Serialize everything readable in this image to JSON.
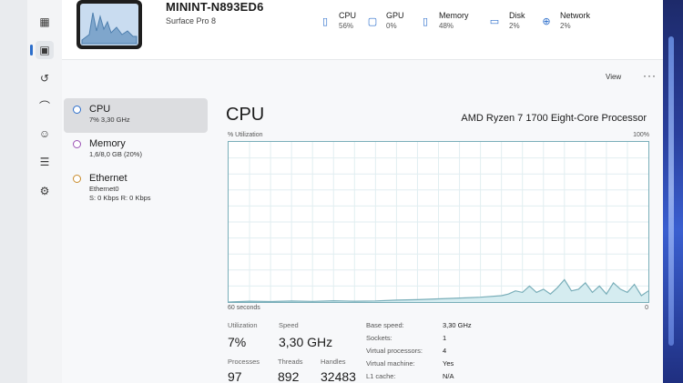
{
  "device": {
    "name": "MININT-N893ED6",
    "model": "Surface Pro 8"
  },
  "metrics": [
    {
      "label": "CPU",
      "value": "56%",
      "icon": "cpu-icon"
    },
    {
      "label": "GPU",
      "value": "0%",
      "icon": "gpu-icon"
    },
    {
      "label": "Memory",
      "value": "48%",
      "icon": "memory-icon"
    },
    {
      "label": "Disk",
      "value": "2%",
      "icon": "disk-icon"
    },
    {
      "label": "Network",
      "value": "2%",
      "icon": "network-icon"
    }
  ],
  "toolbar": {
    "view_label": "View",
    "more_label": "···"
  },
  "device_list": [
    {
      "title": "CPU",
      "sub1": "7% 3,30 GHz",
      "sub2": ""
    },
    {
      "title": "Memory",
      "sub1": "1,6/8,0 GB (20%)",
      "sub2": ""
    },
    {
      "title": "Ethernet",
      "sub1": "Ethernet0",
      "sub2": "S: 0 Kbps R: 0 Kbps"
    }
  ],
  "main": {
    "title": "CPU",
    "processor": "AMD Ryzen 7 1700 Eight-Core Processor",
    "graph_label": "% Utilization",
    "graph_max": "100%",
    "time_span": "60 seconds",
    "graph_min": "0"
  },
  "chart_data": {
    "type": "area",
    "x": [
      0,
      3,
      6,
      9,
      12,
      15,
      18,
      21,
      24,
      27,
      30,
      33,
      36,
      39,
      40,
      41,
      42,
      43,
      44,
      45,
      46,
      47,
      48,
      49,
      50,
      51,
      52,
      53,
      54,
      55,
      56,
      57,
      58,
      59,
      60
    ],
    "values": [
      0,
      0.5,
      0.3,
      0.6,
      0.4,
      0.8,
      0.5,
      0.7,
      1.2,
      1.5,
      2,
      2.5,
      3,
      4,
      5,
      7,
      6,
      10,
      6,
      8,
      5,
      9,
      14,
      7,
      8,
      12,
      6,
      10,
      5,
      12,
      8,
      6,
      11,
      4,
      7
    ],
    "ylim": [
      0,
      100
    ],
    "xlabel": "60 seconds",
    "ylabel": "% Utilization",
    "grid": true
  },
  "stats": {
    "utilization_label": "Utilization",
    "utilization_value": "7%",
    "speed_label": "Speed",
    "speed_value": "3,30 GHz",
    "processes_label": "Processes",
    "processes_value": "97",
    "threads_label": "Threads",
    "threads_value": "892",
    "handles_label": "Handles",
    "handles_value": "32483"
  },
  "details": [
    {
      "key": "Base speed:",
      "value": "3,30 GHz"
    },
    {
      "key": "Sockets:",
      "value": "1"
    },
    {
      "key": "Virtual processors:",
      "value": "4"
    },
    {
      "key": "Virtual machine:",
      "value": "Yes"
    },
    {
      "key": "L1 cache:",
      "value": "N/A"
    }
  ],
  "colors": {
    "accent": "#2c6ecb",
    "graph_line": "#79aeb9",
    "graph_fill": "#d5ecf0"
  }
}
